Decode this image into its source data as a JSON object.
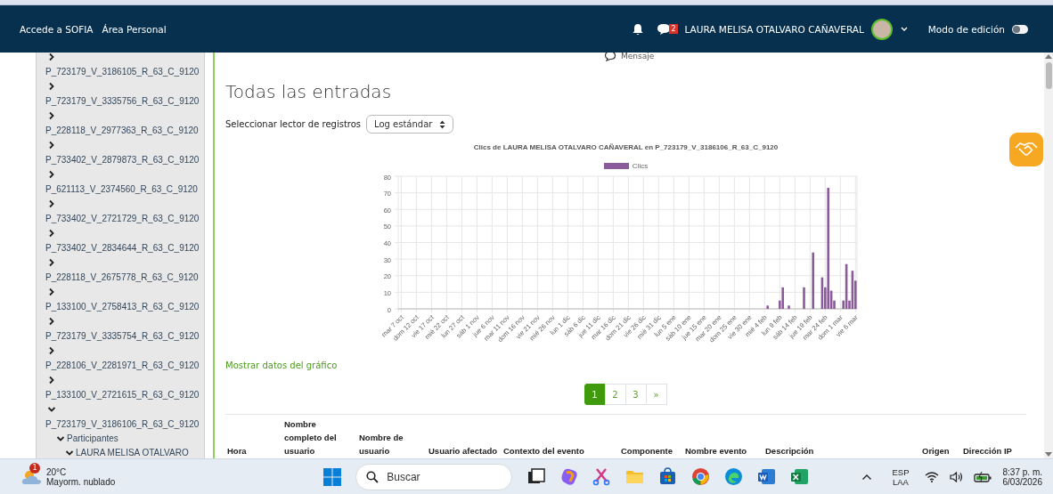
{
  "header": {
    "links": [
      "Accede a SOFIA",
      "Área Personal"
    ],
    "message_count": "2",
    "user_name": "LAURA MELISA OTALVARO CAÑAVERAL",
    "edit_mode": {
      "label": "Modo de edición",
      "on": false
    }
  },
  "sidebar": {
    "items": [
      {
        "label": "P_723179_V_3186105_R_63_C_9120",
        "expanded": false
      },
      {
        "label": "P_723179_V_3335756_R_63_C_9120",
        "expanded": false
      },
      {
        "label": "P_228118_V_2977363_R_63_C_9120",
        "expanded": false
      },
      {
        "label": "P_733402_V_2879873_R_63_C_9120",
        "expanded": false
      },
      {
        "label": "P_621113_V_2374560_R_63_C_9120",
        "expanded": false
      },
      {
        "label": "P_733402_V_2721729_R_63_C_9120",
        "expanded": false
      },
      {
        "label": "P_733402_V_2834644_R_63_C_9120",
        "expanded": false
      },
      {
        "label": "P_228118_V_2675778_R_63_C_9120",
        "expanded": false
      },
      {
        "label": "P_133100_V_2758413_R_63_C_9120",
        "expanded": false
      },
      {
        "label": "P_723179_V_3335754_R_63_C_9120",
        "expanded": false
      },
      {
        "label": "P_228106_V_2281971_R_63_C_9120",
        "expanded": false
      },
      {
        "label": "P_133100_V_2721615_R_63_C_9120",
        "expanded": false
      },
      {
        "label": "P_723179_V_3186106_R_63_C_9120",
        "expanded": true,
        "children": [
          {
            "label": "Participantes",
            "expanded": true,
            "children": [
              {
                "label": "LAURA MELISA OTALVARO",
                "expanded": true
              }
            ]
          }
        ]
      }
    ]
  },
  "main": {
    "message_link": "Mensaje",
    "title": "Todas las entradas",
    "log_reader": {
      "label": "Seleccionar lector de registros",
      "value": "Log estándar"
    },
    "chart_title": "Clics de LAURA MELISA OTALVARO CAÑAVERAL en P_723179_V_3186106_R_63_C_9120",
    "chart_data": {
      "type": "bar",
      "categories": [
        "mar 7 oct",
        null,
        null,
        null,
        null,
        "dom 12 oct",
        null,
        null,
        null,
        null,
        "vie 17 oct",
        null,
        null,
        null,
        null,
        "mié 22 oct",
        null,
        null,
        null,
        null,
        "lun 27 oct",
        null,
        null,
        null,
        null,
        "sáb 1 nov",
        null,
        null,
        null,
        null,
        "jue 6 nov",
        null,
        null,
        null,
        null,
        "mar 11 nov",
        null,
        null,
        null,
        null,
        "dom 16 nov",
        null,
        null,
        null,
        null,
        "vie 21 nov",
        null,
        null,
        null,
        null,
        "mié 26 nov",
        null,
        null,
        null,
        null,
        "lun 1 dic",
        null,
        null,
        null,
        null,
        "sáb 6 dic",
        null,
        null,
        null,
        null,
        "jue 11 dic",
        null,
        null,
        null,
        null,
        "mar 16 dic",
        null,
        null,
        null,
        null,
        "dom 21 dic",
        null,
        null,
        null,
        null,
        "vie 26 dic",
        null,
        null,
        null,
        null,
        "mié 31 dic",
        null,
        null,
        null,
        null,
        "lun 5 ene",
        null,
        null,
        null,
        null,
        "sáb 10 ene",
        null,
        null,
        null,
        null,
        "jue 15 ene",
        null,
        null,
        null,
        null,
        "mar 20 ene",
        null,
        null,
        null,
        null,
        "dom 25 ene",
        null,
        null,
        null,
        null,
        "vie 30 ene",
        null,
        null,
        null,
        null,
        "mié 4 feb",
        null,
        null,
        null,
        null,
        "lun 9 feb",
        null,
        null,
        null,
        null,
        "sáb 14 feb",
        null,
        null,
        null,
        null,
        "jue 19 feb",
        null,
        null,
        null,
        null,
        "mar 24 feb",
        null,
        null,
        null,
        null,
        "dom 1 mar",
        null,
        null,
        null,
        null,
        "vie 6 mar"
      ],
      "series": [
        {
          "name": "Clics",
          "color": "#8a5a9b",
          "values": [
            0,
            0,
            0,
            0,
            0,
            0,
            0,
            0,
            0,
            0,
            0,
            0,
            0,
            0,
            0,
            0,
            0,
            0,
            0,
            0,
            0,
            0,
            0,
            0,
            0,
            0,
            0,
            0,
            0,
            0,
            0,
            0,
            0,
            0,
            0,
            0,
            0,
            0,
            0,
            0,
            0,
            0,
            0,
            0,
            0,
            0,
            0,
            0,
            0,
            0,
            0,
            0,
            0,
            0,
            0,
            0,
            0,
            0,
            0,
            0,
            0,
            0,
            0,
            0,
            0,
            0,
            0,
            0,
            0,
            0,
            0,
            0,
            0,
            0,
            0,
            0,
            0,
            0,
            0,
            0,
            0,
            0,
            0,
            0,
            0,
            0,
            0,
            0,
            0,
            0,
            0,
            0,
            0,
            0,
            0,
            0,
            0,
            0,
            0,
            0,
            0,
            0,
            0,
            0,
            0,
            0,
            0,
            0,
            0,
            0,
            0,
            0,
            0,
            0,
            0,
            0,
            0,
            0,
            0,
            0,
            0,
            2,
            0,
            0,
            0,
            5,
            13,
            0,
            2,
            0,
            0,
            0,
            0,
            13,
            0,
            0,
            34,
            0,
            0,
            19,
            13,
            73,
            11,
            5,
            0,
            0,
            5,
            27,
            5,
            23,
            17
          ]
        }
      ],
      "grid": true,
      "ylim": [
        0,
        80
      ],
      "yticks": [
        0,
        10,
        20,
        30,
        40,
        50,
        60,
        70,
        80
      ]
    },
    "chart_link": "Mostrar datos del gráfico",
    "pagination": [
      {
        "label": "1",
        "selected": true
      },
      {
        "label": "2",
        "selected": false
      },
      {
        "label": "3",
        "selected": false
      },
      {
        "label": "»",
        "selected": false
      }
    ],
    "table": {
      "columns": [
        "Hora",
        "Nombre completo del usuario",
        "Nombre de usuario",
        "Usuario afectado",
        "Contexto del evento",
        "Componente",
        "Nombre evento",
        "Descripción",
        "Origen",
        "Dirección IP"
      ]
    }
  },
  "taskbar": {
    "weather": {
      "badge": "1",
      "temperature": "20°C",
      "condition": "Mayorm. nublado"
    },
    "search_placeholder": "Buscar",
    "language": [
      "ESP",
      "LAA"
    ],
    "time": "8:37 p. m.",
    "date": "6/03/2026"
  }
}
